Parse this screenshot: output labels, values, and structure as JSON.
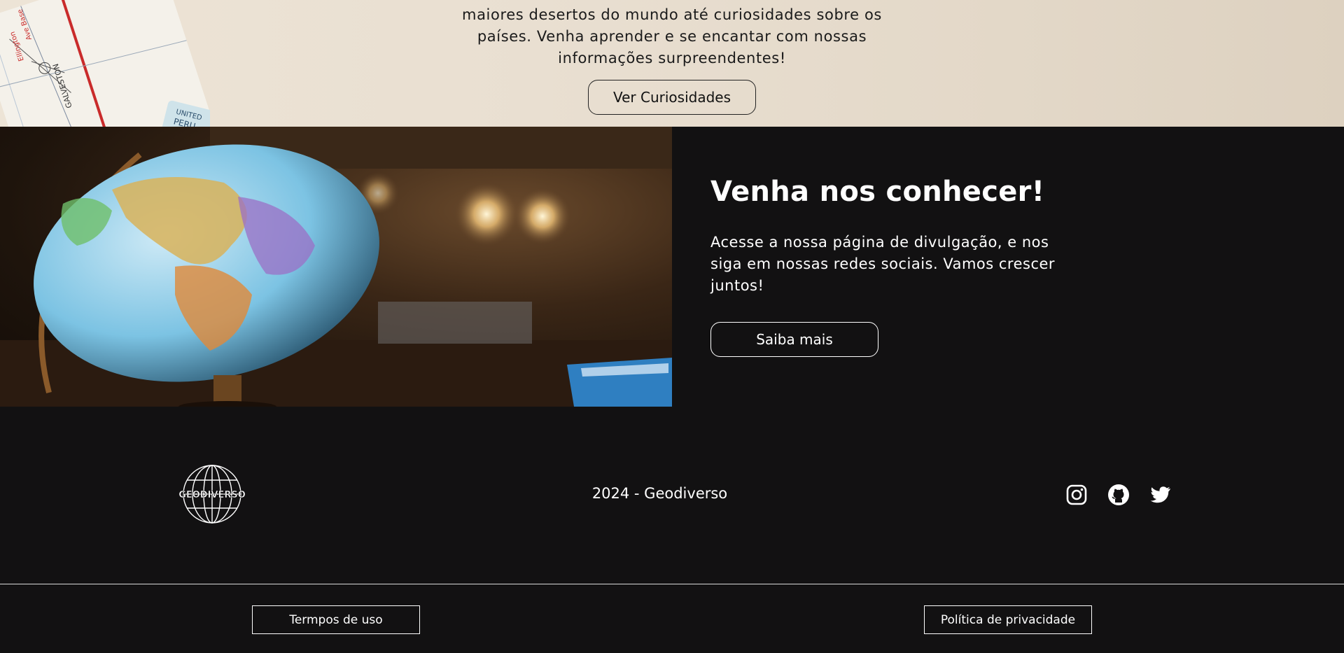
{
  "hero": {
    "lines": [
      "maiores desertos do mundo até curiosidades sobre os",
      "países. Venha aprender e se encantar com nossas",
      "informações surpreendentes!"
    ],
    "button_label": "Ver Curiosidades",
    "map_labels": {
      "galveston": "GALVESTON",
      "united": "UNITED",
      "peru": "PERU",
      "road": "Ave Base",
      "ellington": "Ellington"
    }
  },
  "about": {
    "title": "Venha nos conhecer!",
    "description_lines": [
      "Acesse a nossa página de divulgação, e nos",
      "siga em nossas redes sociais. Vamos crescer",
      "juntos!"
    ],
    "button_label": "Saiba mais"
  },
  "footer": {
    "logo_text": "GEODIVERSO",
    "copyright": "2024 - Geodiverso",
    "social": [
      "instagram-icon",
      "github-icon",
      "twitter-icon"
    ],
    "terms_label": "Termpos de uso",
    "privacy_label": "Política de privacidade"
  },
  "colors": {
    "dark_bg": "#121112",
    "hero_bg": "#e9dfd1",
    "text_light": "#ffffff"
  }
}
